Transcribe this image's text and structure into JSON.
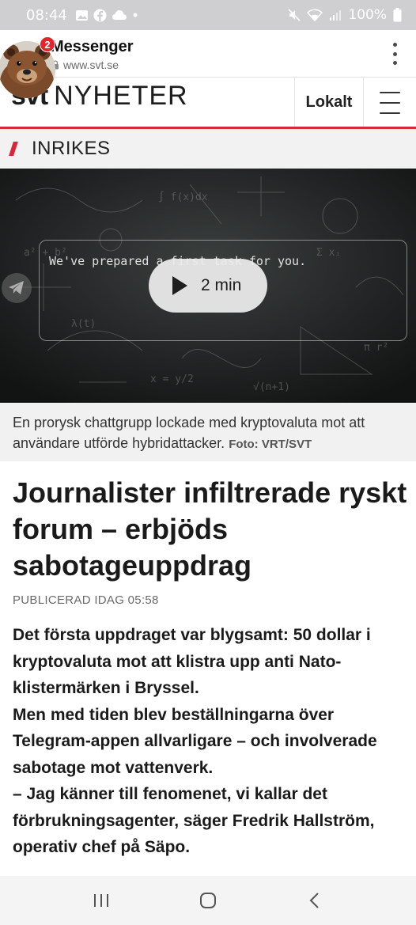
{
  "status_bar": {
    "time": "08:44",
    "battery": "100%",
    "icons": [
      "gallery-icon",
      "facebook-icon",
      "cloud-icon",
      "dot-icon",
      "mute-icon",
      "wifi-icon",
      "signal-icon",
      "battery-icon"
    ]
  },
  "browser": {
    "title": "Messenger",
    "url": "www.svt.se",
    "menu_icon": "more-vert-icon"
  },
  "chat_head": {
    "badge_count": "2"
  },
  "site_header": {
    "logo_svt": "svt",
    "logo_nyheter": "NYHETER",
    "lokalt": "Lokalt",
    "menu_icon": "hamburger-icon",
    "accent": "#d8263a"
  },
  "section": {
    "label": "INRIKES"
  },
  "video": {
    "prompt": "We've prepared a first task for you.",
    "duration": "2 min"
  },
  "caption": {
    "text": "En prorysk chattgrupp lockade med kryptovaluta mot att användare utförde hybridattacker.",
    "credit": "Foto: VRT/SVT"
  },
  "article": {
    "headline": "Journalister infiltrerade ryskt forum – erbjöds sabotageuppdrag",
    "published": "PUBLICERAD IDAG 05:58",
    "lead": [
      "Det första uppdraget var blygsamt: 50 dollar i kryptovaluta mot att klistra upp anti Nato-klistermärken i Bryssel.",
      "Men med tiden blev beställningarna över Telegram-appen allvarligare – och involverade sabotage mot vattenverk.",
      "– Jag känner till fenomenet, vi kallar det förbrukningsagenter, säger Fredrik Hallström, operativ chef på Säpo."
    ]
  },
  "nav_bar": {
    "icons": [
      "recent-apps-icon",
      "home-icon",
      "back-icon"
    ]
  }
}
